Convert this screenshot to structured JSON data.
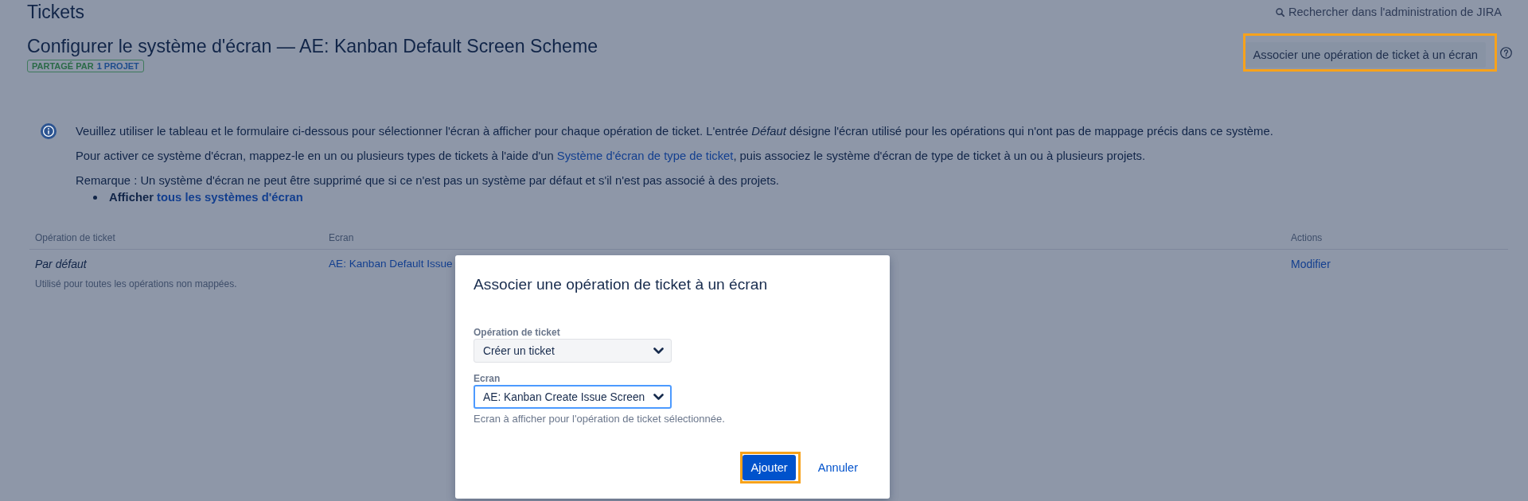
{
  "header": {
    "title": "Tickets",
    "search_link": "Rechercher dans l'administration de JIRA"
  },
  "page": {
    "heading": "Configurer le système d'écran — AE: Kanban Default Screen Scheme",
    "lozenge": {
      "label": "PARTAGÉ PAR",
      "count": "1 PROJET"
    },
    "action_button": {
      "label": "Associer une opération de ticket à un écran",
      "highlighted": true
    }
  },
  "info": {
    "intro": "Veuillez utiliser le tableau et le formulaire ci-dessous pour sélectionner l'écran à afficher pour chaque opération de ticket. L'entrée *Défaut* désigne l'écran utilisé pour les opérations qui n'ont pas de mappage précis dans ce système.",
    "activation": {
      "before": "Pour activer ce système d'écran, mappez-le en un ou plusieurs types de tickets à l'aide d'un",
      "link": "Système d'écran de type de ticket",
      "after": ", puis associez le système d'écran de type de ticket à un ou à plusieurs projets."
    },
    "note": "Remarque : Un système d'écran ne peut être supprimé que si ce n'est pas un système par défaut et s'il n'est pas associé à des projets.",
    "bullets": [
      {
        "text": "Afficher",
        "link": "tous les systèmes d'écran"
      }
    ]
  },
  "table": {
    "columns": [
      "Opération de ticket",
      "Ecran",
      "Actions"
    ],
    "rows": [
      {
        "operation": "Par défaut",
        "is_default": true,
        "description": "Utilisé pour toutes les opérations non mappées.",
        "screen": "AE: Kanban Default Issue",
        "action": "Modifier"
      }
    ]
  },
  "modal": {
    "title": "Associer une opération de ticket à un écran",
    "fields": [
      {
        "label": "Opération de ticket",
        "value": "Créer un ticket",
        "focused": false
      },
      {
        "label": "Ecran",
        "value": "AE: Kanban Create Issue Screen",
        "focused": true,
        "help": "Ecran à afficher pour l'opération de ticket sélectionnée."
      }
    ],
    "buttons": [
      {
        "label": "Ajouter",
        "kind": "primary",
        "highlighted": true
      },
      {
        "label": "Annuler",
        "kind": "link",
        "highlighted": false
      }
    ]
  }
}
